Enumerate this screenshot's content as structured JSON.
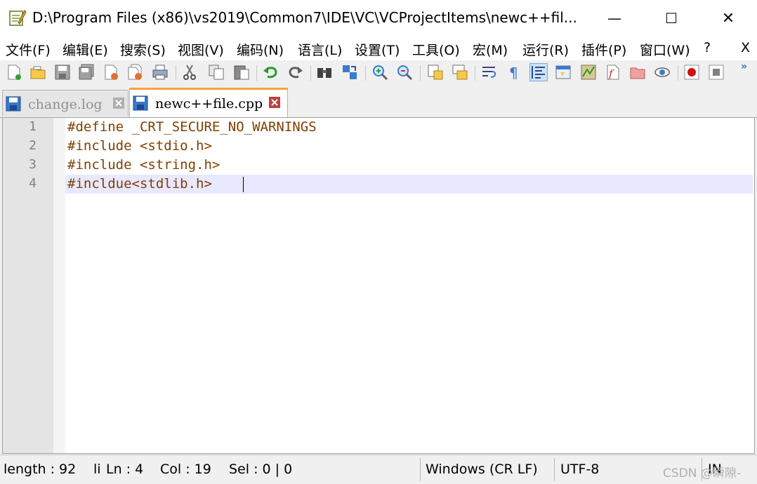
{
  "window": {
    "title": "D:\\Program Files (x86)\\vs2019\\Common7\\IDE\\VC\\VCProjectItems\\newc++fil...",
    "min_glyph": "—",
    "max_glyph": "☐",
    "close_glyph": "✕"
  },
  "menu": {
    "items": [
      "文件(F)",
      "编辑(E)",
      "搜索(S)",
      "视图(V)",
      "编码(N)",
      "语言(L)",
      "设置(T)",
      "工具(O)",
      "宏(M)",
      "运行(R)",
      "插件(P)",
      "窗口(W)",
      "?"
    ],
    "close_label": "X"
  },
  "toolbar": {
    "icons": [
      "new-file-icon",
      "open-file-icon",
      "save-icon",
      "save-all-icon",
      "close-icon",
      "close-all-icon",
      "print-icon",
      "cut-icon",
      "copy-icon",
      "paste-icon",
      "undo-icon",
      "redo-icon",
      "find-icon",
      "replace-icon",
      "zoom-in-icon",
      "zoom-out-icon",
      "sync-vertical-icon",
      "sync-horizontal-icon",
      "word-wrap-icon",
      "show-all-chars-icon",
      "indent-guide-icon",
      "udl-icon",
      "doc-map-icon",
      "function-list-icon",
      "folder-workspace-icon",
      "monitor-icon",
      "record-macro-icon",
      "stop-macro-icon"
    ],
    "more_glyph": "»"
  },
  "tabs": [
    {
      "label": "change.log",
      "active": false
    },
    {
      "label": "newc++file.cpp",
      "active": true
    }
  ],
  "editor": {
    "lines": [
      {
        "num": "1",
        "text": "#define _CRT_SECURE_NO_WARNINGS"
      },
      {
        "num": "2",
        "text": "#include <stdio.h>"
      },
      {
        "num": "3",
        "text": "#include <string.h>"
      },
      {
        "num": "4",
        "text": "#incldue<stdlib.h>"
      }
    ],
    "current_line": 4
  },
  "status": {
    "length": "length : 92",
    "li": "li",
    "ln": "Ln : 4",
    "col": "Col : 19",
    "sel": "Sel : 0 | 0",
    "eol": "Windows (CR LF)",
    "encoding": "UTF-8",
    "ins": "IN",
    "watermark": "CSDN @瞬隙-"
  },
  "colors": {
    "preprocessor": "#804000",
    "current_line": "#e8e8ff",
    "active_tab_accent": "#f8a23a",
    "line_number": "#808080"
  }
}
